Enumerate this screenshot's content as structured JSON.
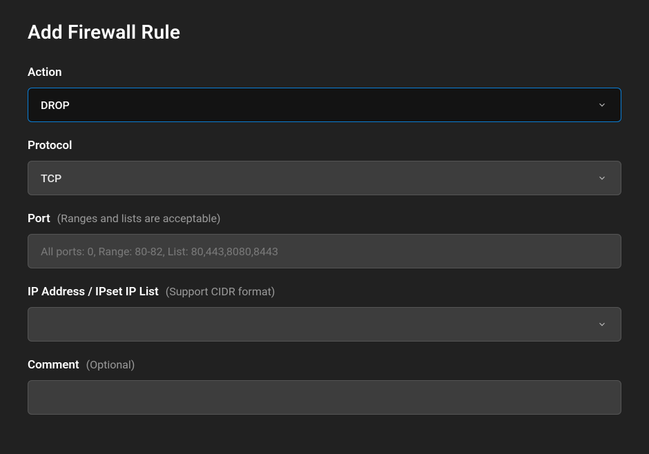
{
  "page": {
    "title": "Add Firewall Rule"
  },
  "fields": {
    "action": {
      "label": "Action",
      "value": "DROP"
    },
    "protocol": {
      "label": "Protocol",
      "value": "TCP"
    },
    "port": {
      "label": "Port",
      "hint": "(Ranges and lists are acceptable)",
      "placeholder": "All ports: 0, Range: 80-82, List: 80,443,8080,8443",
      "value": ""
    },
    "ip": {
      "label": "IP Address / IPset IP List",
      "hint": "(Support CIDR format)",
      "value": ""
    },
    "comment": {
      "label": "Comment",
      "hint": "(Optional)",
      "value": ""
    }
  }
}
